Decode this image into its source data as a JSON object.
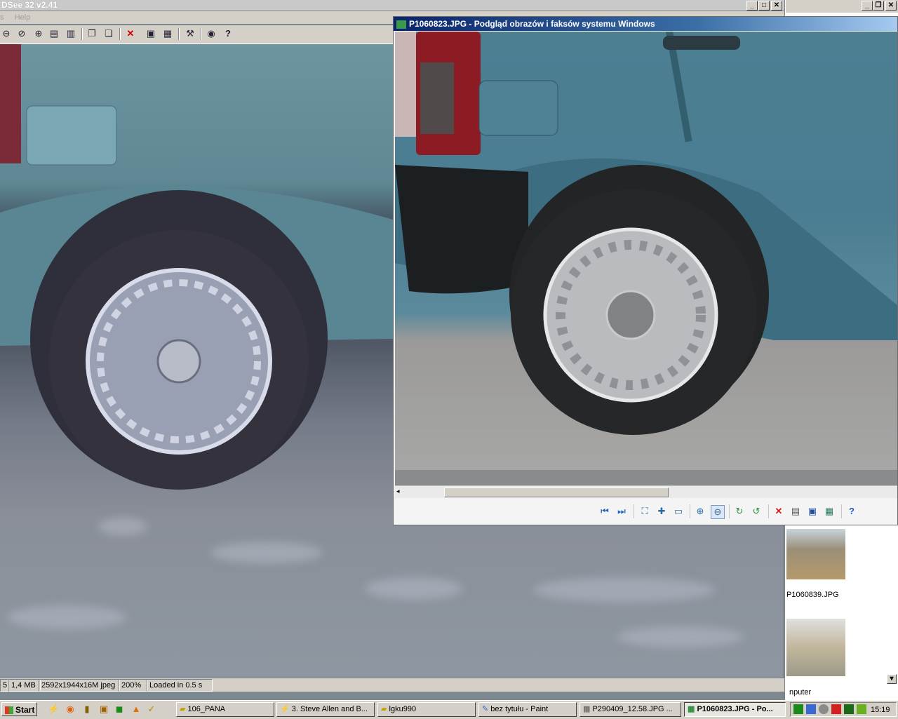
{
  "acdsee": {
    "title": "DSee 32 v2.41",
    "menu": [
      "s",
      "Help"
    ],
    "status": [
      "5",
      "1,4 MB",
      "2592x1944x16M jpeg",
      "200%",
      "Loaded in 0.5 s"
    ]
  },
  "viewer": {
    "title": "P1060823.JPG - Podgląd obrazów i faksów systemu Windows"
  },
  "thumbs": {
    "items": [
      {
        "label": "P1060839.JPG"
      }
    ],
    "partial_label": "nputer"
  },
  "taskbar": {
    "start": "Start",
    "tasks": [
      {
        "label": "106_PANA"
      },
      {
        "label": "3. Steve Allen and B..."
      },
      {
        "label": "lgku990"
      },
      {
        "label": "bez tytułu - Paint"
      },
      {
        "label": "P290409_12.58.JPG ..."
      },
      {
        "label": "P1060823.JPG - Po..."
      }
    ],
    "clock": "15:19"
  }
}
